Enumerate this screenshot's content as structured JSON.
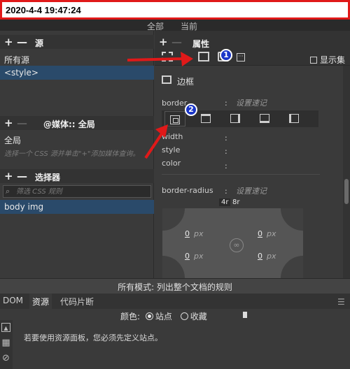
{
  "timestamp": "2020-4-4 19:47:24",
  "mode_tabs": {
    "all": "全部",
    "current": "当前"
  },
  "sources": {
    "title": "源",
    "plus": "+",
    "minus": "—",
    "items": [
      "所有源",
      "<style>"
    ]
  },
  "media": {
    "title": "@媒体:: 全局",
    "plus": "+",
    "minus": "—",
    "item": "全局",
    "hint": "选择一个 CSS 源并单击\"+\"添加媒体查询。"
  },
  "selectors": {
    "title": "选择器",
    "plus": "+",
    "minus": "—",
    "filter_placeholder": "筛选 CSS 规则",
    "items": [
      "body img"
    ]
  },
  "properties": {
    "title": "属性",
    "plus": "+",
    "minus": "—",
    "show_set": "显示集",
    "section": "边框",
    "border_label": "border",
    "shorthand": "设置速记",
    "colon": ":",
    "width_label": "width",
    "style_label": "style",
    "color_label": "color",
    "radius_label": "border-radius",
    "radius_shorthand": "设置速记",
    "radius_4r": "4r",
    "radius_8r": "8r",
    "radius_values": [
      {
        "value": "0",
        "unit": "px"
      },
      {
        "value": "0",
        "unit": "px"
      },
      {
        "value": "0",
        "unit": "px"
      },
      {
        "value": "0",
        "unit": "px"
      }
    ]
  },
  "status_text": "所有模式: 列出整个文档的规则",
  "bottom_tabs": [
    "DOM",
    "资源",
    "代码片断"
  ],
  "assets": {
    "color_label": "颜色:",
    "option_site": "站点",
    "option_favorites": "收藏",
    "message": "若要使用资源面板，您必须先定义站点。"
  },
  "annotations": [
    "1",
    "2"
  ],
  "colors": {
    "highlight": "#2a4a6a",
    "badge": "#1a36c8",
    "arrow": "#e01919",
    "stamp_border": "#e01919"
  }
}
